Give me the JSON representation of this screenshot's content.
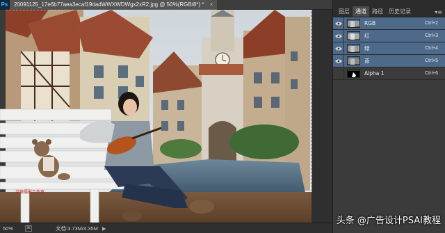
{
  "app": {
    "logo_text": "Ps"
  },
  "document": {
    "tab_title": "20091125_17e6b77aea3ecaf19dadWWXWDWgx2xR2.jpg @ 50%(RGB/8*) *",
    "close_glyph": "×"
  },
  "canvas": {
    "bench_logo_text": "艾德摄影工作室",
    "clock_face": "clock-face"
  },
  "status": {
    "zoom": "50%",
    "doc_info": "文档:3.73M/4.35M",
    "arrow": "▶"
  },
  "panel": {
    "tabs": [
      {
        "label": "图层",
        "active": false
      },
      {
        "label": "通道",
        "active": true
      },
      {
        "label": "路径",
        "active": false
      },
      {
        "label": "历史记录",
        "active": false
      }
    ],
    "menu_glyph": "▾≡",
    "channels": [
      {
        "name": "RGB",
        "shortcut": "Ctrl+2",
        "visible": true,
        "selected": true
      },
      {
        "name": "红",
        "shortcut": "Ctrl+3",
        "visible": true,
        "selected": true
      },
      {
        "name": "绿",
        "shortcut": "Ctrl+4",
        "visible": true,
        "selected": true
      },
      {
        "name": "蓝",
        "shortcut": "Ctrl+5",
        "visible": true,
        "selected": true
      },
      {
        "name": "Alpha 1",
        "shortcut": "Ctrl+6",
        "visible": false,
        "selected": false
      }
    ]
  },
  "watermark": {
    "text": "头条 @广告设计PSAI教程"
  },
  "colors": {
    "selection_blue": "#4e6a8b",
    "panel_bg": "#3b3b3b",
    "tabbar_bg": "#3c3c3c"
  }
}
